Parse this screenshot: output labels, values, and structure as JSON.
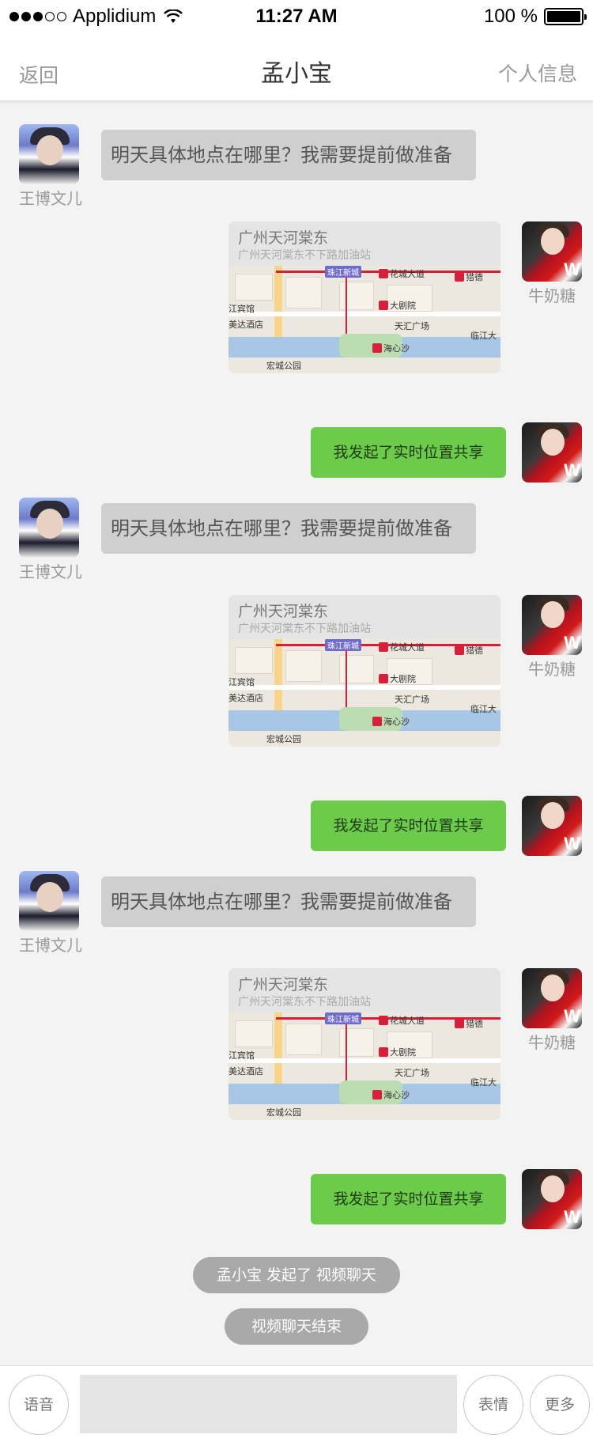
{
  "status_bar": {
    "carrier": "Applidium",
    "time": "11:27 AM",
    "battery": "100 %"
  },
  "nav": {
    "back": "返回",
    "title": "孟小宝",
    "right": "个人信息"
  },
  "senders": {
    "left": "王博文儿",
    "right": "牛奶糖"
  },
  "messages": {
    "m1": "明天具体地点在哪里？我需要提前做准备",
    "m2_title": "广州天河棠东",
    "m2_sub": "广州天河棠东不下路加油站",
    "m3": "我发起了实时位置共享",
    "m4": "明天具体地点在哪里？我需要提前做准备",
    "m5_title": "广州天河棠东",
    "m5_sub": "广州天河棠东不下路加油站",
    "m6": "我发起了实时位置共享",
    "m7": "明天具体地点在哪里？我需要提前做准备",
    "m8_title": "广州天河棠东",
    "m8_sub": "广州天河棠东不下路加油站",
    "m9": "我发起了实时位置共享"
  },
  "map_labels": {
    "station": "珠江新城",
    "road": "花城大道",
    "lie": "猎德",
    "theatre": "大剧院",
    "tianhui": "天汇广场",
    "jiangbin": "江宾馆",
    "hotel": "美达酒店",
    "haixinsha": "海心沙",
    "park": "宏城公园",
    "linjiang": "临江大"
  },
  "notices": {
    "video_start": "孟小宝 发起了 视频聊天",
    "video_end": "视频聊天结束"
  },
  "input_bar": {
    "voice": "语音",
    "emoji": "表情",
    "more": "更多"
  },
  "colors": {
    "accent_green": "#6dcb4b",
    "bubble_gray": "#cfcfcf",
    "notice_gray": "#a9a9a9"
  }
}
